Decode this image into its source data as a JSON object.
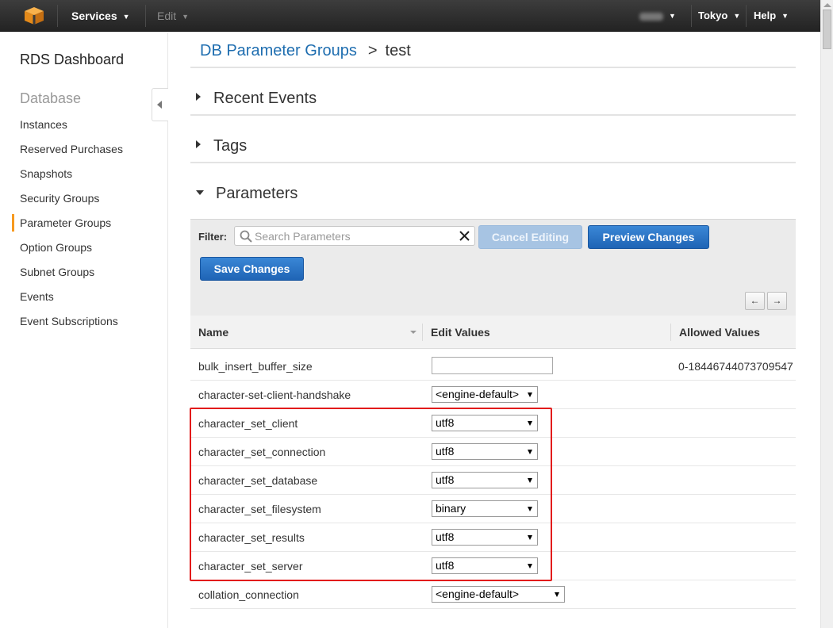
{
  "topbar": {
    "services_label": "Services",
    "edit_label": "Edit",
    "account_label": "",
    "region_label": "Tokyo",
    "help_label": "Help"
  },
  "sidebar": {
    "title": "RDS Dashboard",
    "section": "Database",
    "items": [
      {
        "label": "Instances"
      },
      {
        "label": "Reserved Purchases"
      },
      {
        "label": "Snapshots"
      },
      {
        "label": "Security Groups"
      },
      {
        "label": "Parameter Groups",
        "active": true
      },
      {
        "label": "Option Groups"
      },
      {
        "label": "Subnet Groups"
      },
      {
        "label": "Events"
      },
      {
        "label": "Event Subscriptions"
      }
    ]
  },
  "breadcrumb": {
    "link": "DB Parameter Groups",
    "separator": ">",
    "current": "test"
  },
  "sections": {
    "recent_events": "Recent Events",
    "tags": "Tags",
    "parameters": "Parameters"
  },
  "toolbar": {
    "filter_label": "Filter:",
    "search_placeholder": "Search Parameters",
    "cancel_label": "Cancel Editing",
    "preview_label": "Preview Changes",
    "save_label": "Save Changes",
    "prev_page": "←",
    "next_page": "→"
  },
  "table": {
    "headers": [
      "Name",
      "Edit Values",
      "Allowed Values"
    ],
    "rows": [
      {
        "name": "bulk_insert_buffer_size",
        "edit": "",
        "edit_type": "text",
        "allowed": "0-18446744073709547"
      },
      {
        "name": "character-set-client-handshake",
        "edit": "<engine-default>",
        "edit_type": "select",
        "allowed": ""
      },
      {
        "name": "character_set_client",
        "edit": "utf8",
        "edit_type": "select",
        "allowed": ""
      },
      {
        "name": "character_set_connection",
        "edit": "utf8",
        "edit_type": "select",
        "allowed": ""
      },
      {
        "name": "character_set_database",
        "edit": "utf8",
        "edit_type": "select",
        "allowed": ""
      },
      {
        "name": "character_set_filesystem",
        "edit": "binary",
        "edit_type": "select",
        "allowed": ""
      },
      {
        "name": "character_set_results",
        "edit": "utf8",
        "edit_type": "select",
        "allowed": ""
      },
      {
        "name": "character_set_server",
        "edit": "utf8",
        "edit_type": "select",
        "allowed": ""
      },
      {
        "name": "collation_connection",
        "edit": "<engine-default>",
        "edit_type": "select",
        "allowed": ""
      }
    ]
  },
  "colors": {
    "accent": "#f79a1f",
    "link": "#1f6eb0",
    "button": "#1f64b5",
    "highlight": "#e21b1b"
  }
}
